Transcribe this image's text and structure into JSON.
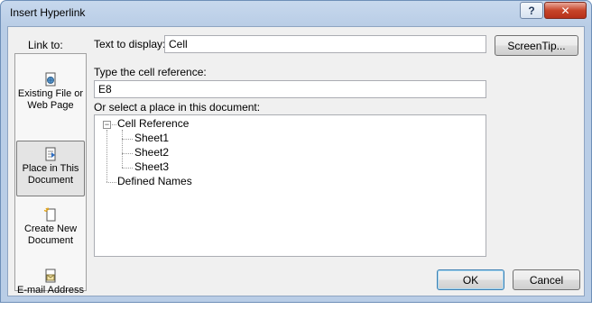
{
  "window": {
    "title": "Insert Hyperlink",
    "help_glyph": "?",
    "close_glyph": "✕"
  },
  "link_to": {
    "label": "Link to:",
    "items": [
      {
        "line1": "Existing File or",
        "line2": "Web Page",
        "icon": "web-page-icon",
        "selected": false
      },
      {
        "line1": "Place in This",
        "line2": "Document",
        "icon": "document-place-icon",
        "selected": true
      },
      {
        "line1": "Create New",
        "line2": "Document",
        "icon": "new-document-icon",
        "selected": false
      },
      {
        "line1": "E-mail Address",
        "line2": "",
        "icon": "email-icon",
        "selected": false
      }
    ]
  },
  "text_to_display": {
    "label": "Text to display:",
    "value": "Cell"
  },
  "screentip_label": "ScreenTip...",
  "cell_reference": {
    "label": "Type the cell reference:",
    "value": "E8"
  },
  "place_in_doc": {
    "label": "Or select a place in this document:",
    "tree": {
      "root_label": "Cell Reference",
      "root_expander": "−",
      "sheets": [
        "Sheet1",
        "Sheet2",
        "Sheet3"
      ],
      "defined_names": "Defined Names"
    }
  },
  "buttons": {
    "ok": "OK",
    "cancel": "Cancel"
  },
  "colors": {
    "title_bar": "#b9cde6",
    "close_button": "#c7452a",
    "dialog_bg": "#f0f0f0"
  }
}
